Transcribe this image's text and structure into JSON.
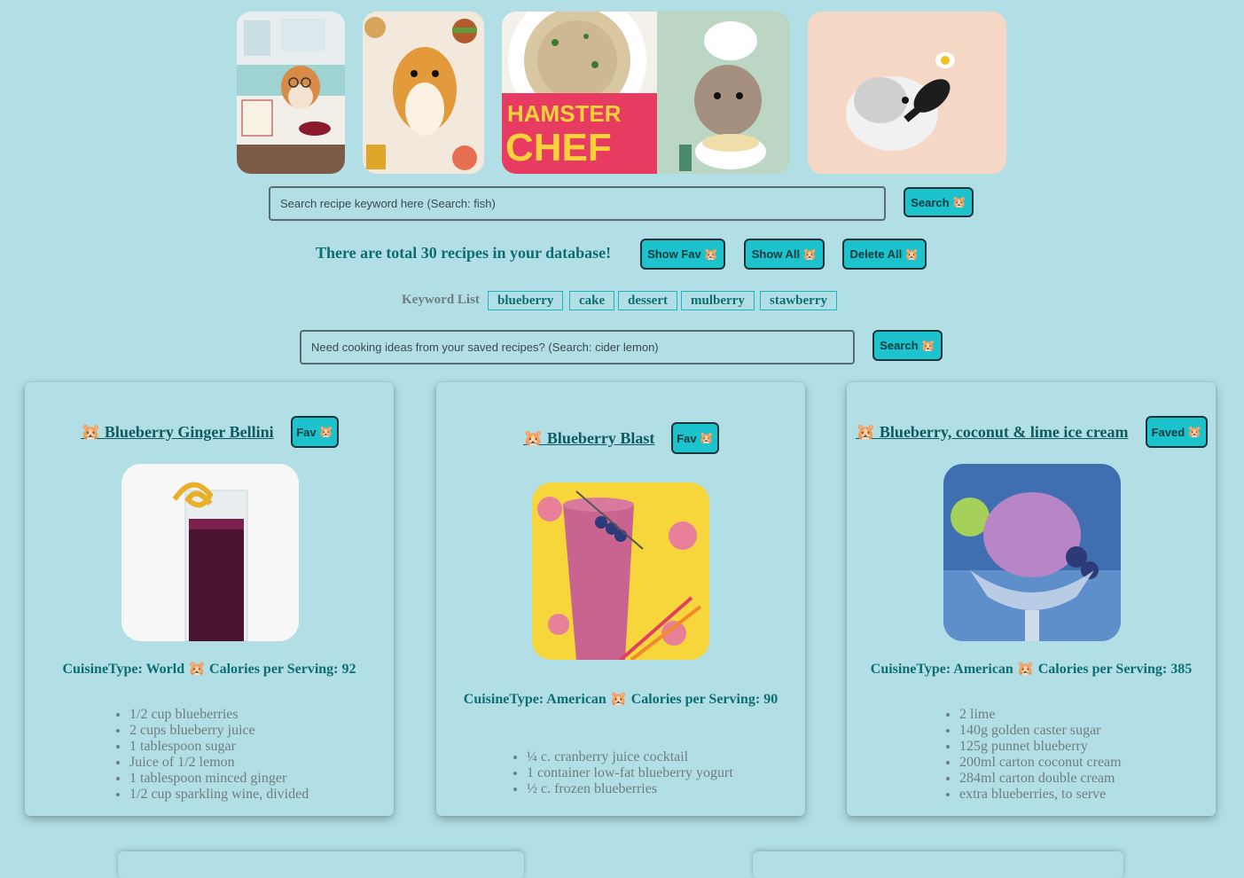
{
  "banner": {
    "chef_logo_line1": "HAMSTER",
    "chef_logo_line2": "CHEF"
  },
  "search": {
    "placeholder": "Search recipe keyword here (Search: fish)",
    "button_label": "Search",
    "button_icon": "hamster-icon"
  },
  "summary": {
    "total_text": "There are total 30 recipes in your database!",
    "show_fav_label": "Show Fav",
    "show_all_label": "Show All",
    "delete_all_label": "Delete All"
  },
  "keywords": {
    "label": "Keyword List",
    "items": [
      "blueberry",
      "cake",
      "dessert",
      "mulberry",
      "stawberry"
    ]
  },
  "ideas_search": {
    "placeholder": "Need cooking ideas from your saved recipes? (Search: cider lemon)",
    "button_label": "Search"
  },
  "hamster_emoji": "🐹",
  "recipes": [
    {
      "title": "Blueberry Ginger Bellini",
      "fav_label": "Fav",
      "meta": "CuisineType: World 🐹 Calories per Serving: 92",
      "ingredients": [
        "1/2 cup blueberries",
        "2 cups blueberry juice",
        "1 tablespoon sugar",
        "Juice of 1/2 lemon",
        "1 tablespoon minced ginger",
        "1/2 cup sparkling wine, divided"
      ]
    },
    {
      "title": "Blueberry Blast",
      "fav_label": "Fav",
      "meta": "CuisineType: American 🐹 Calories per Serving: 90",
      "ingredients": [
        "¼ c. cranberry juice cocktail",
        "1 container low-fat blueberry yogurt",
        "½ c. frozen blueberries"
      ]
    },
    {
      "title": "Blueberry, coconut & lime ice cream",
      "fav_label": "Faved",
      "meta": "CuisineType: American 🐹 Calories per Serving: 385",
      "ingredients": [
        "2 lime",
        "140g golden caster sugar",
        "125g punnet blueberry",
        "200ml carton coconut cream",
        "284ml carton double cream",
        "extra blueberries, to serve"
      ]
    }
  ],
  "colors": {
    "background": "#b1dfe5",
    "button": "#1cc3cc",
    "heading": "#0d6e72",
    "muted": "#6f7d80"
  }
}
